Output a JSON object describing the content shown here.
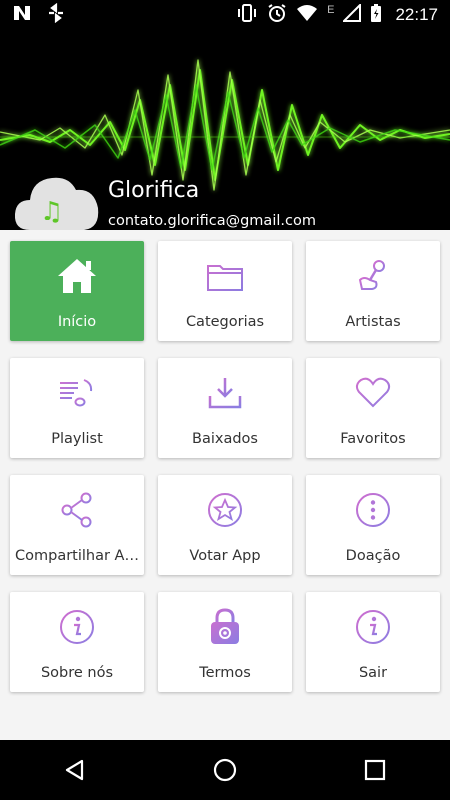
{
  "status_bar": {
    "time": "22:17",
    "icons": [
      "n-notification-icon",
      "sync-icon",
      "vibrate-icon",
      "alarm-icon",
      "wifi-icon",
      "signal-icon",
      "battery-icon"
    ],
    "network_label": "E"
  },
  "header": {
    "app_name": "Glorifica",
    "email": "contato.glorifica@gmail.com",
    "accent_color": "#6ff321"
  },
  "menu": {
    "accent_color": "#4cb05a",
    "icon_color": "#a77bd6",
    "items": [
      {
        "label": "Início",
        "icon": "home-icon",
        "active": true
      },
      {
        "label": "Categorias",
        "icon": "folder-icon",
        "active": false
      },
      {
        "label": "Artistas",
        "icon": "microphone-icon",
        "active": false
      },
      {
        "label": "Playlist",
        "icon": "playlist-icon",
        "active": false
      },
      {
        "label": "Baixados",
        "icon": "download-icon",
        "active": false
      },
      {
        "label": "Favoritos",
        "icon": "heart-icon",
        "active": false
      },
      {
        "label": "Compartilhar A…",
        "icon": "share-icon",
        "active": false
      },
      {
        "label": "Votar App",
        "icon": "star-icon",
        "active": false
      },
      {
        "label": "Doação",
        "icon": "more-icon",
        "active": false
      },
      {
        "label": "Sobre nós",
        "icon": "info-icon",
        "active": false
      },
      {
        "label": "Termos",
        "icon": "lock-icon",
        "active": false
      },
      {
        "label": "Sair",
        "icon": "info-icon",
        "active": false
      }
    ]
  },
  "nav_bar": {
    "buttons": [
      "back-icon",
      "home-icon",
      "recents-icon"
    ]
  }
}
